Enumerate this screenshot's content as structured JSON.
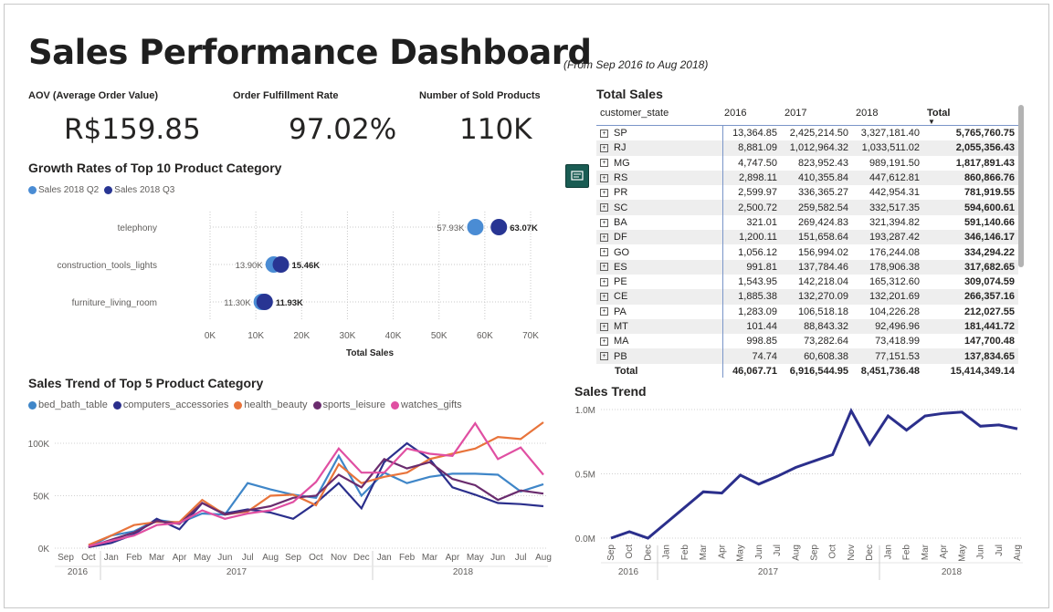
{
  "header": {
    "title": "Sales Performance Dashboard",
    "subtitle": "(From Sep 2016 to Aug 2018)"
  },
  "kpis": [
    {
      "label": "AOV (Average Order Value)",
      "value": "R$159.85"
    },
    {
      "label": "Order Fulfillment Rate",
      "value": "97.02%"
    },
    {
      "label": "Number of Sold Products",
      "value": "110K"
    }
  ],
  "colors": {
    "q2": "#4a8cd4",
    "q3": "#283593",
    "bed_bath_table": "#3f86c8",
    "computers_accessories": "#2b2f8c",
    "health_beauty": "#e8743b",
    "sports_leisure": "#6a2c6e",
    "watches_gifts": "#e04fa2",
    "trend": "#2b2f8c"
  },
  "growth_chart": {
    "title": "Growth Rates of Top 10 Product Category",
    "legend": [
      "Sales 2018 Q2",
      "Sales 2018 Q3"
    ],
    "xlabel": "Total Sales",
    "ticks": [
      "0K",
      "10K",
      "20K",
      "30K",
      "40K",
      "50K",
      "60K",
      "70K"
    ]
  },
  "trend5": {
    "title": "Sales Trend of Top 5 Product Category",
    "legend": [
      "bed_bath_table",
      "computers_accessories",
      "health_beauty",
      "sports_leisure",
      "watches_gifts"
    ],
    "yticks": [
      "100K",
      "50K",
      "0K"
    ],
    "months": [
      "Sep",
      "Oct",
      "Jan",
      "Feb",
      "Mar",
      "Apr",
      "May",
      "Jun",
      "Jul",
      "Aug",
      "Sep",
      "Oct",
      "Nov",
      "Dec",
      "Jan",
      "Feb",
      "Mar",
      "Apr",
      "May",
      "Jun",
      "Jul",
      "Aug"
    ],
    "years": [
      "2016",
      "2017",
      "2018"
    ]
  },
  "sales_trend": {
    "title": "Sales Trend",
    "yticks": [
      "1.0M",
      "0.5M",
      "0.0M"
    ],
    "months": [
      "Sep",
      "Oct",
      "Dec",
      "Jan",
      "Feb",
      "Mar",
      "Apr",
      "May",
      "Jun",
      "Jul",
      "Aug",
      "Sep",
      "Oct",
      "Nov",
      "Dec",
      "Jan",
      "Feb",
      "Mar",
      "Apr",
      "May",
      "Jun",
      "Jul",
      "Aug"
    ],
    "years": [
      "2016",
      "2017",
      "2018"
    ]
  },
  "table": {
    "title": "Total Sales",
    "columns": [
      "customer_state",
      "2016",
      "2017",
      "2018",
      "Total"
    ],
    "rows": [
      [
        "SP",
        "13,364.85",
        "2,425,214.50",
        "3,327,181.40",
        "5,765,760.75"
      ],
      [
        "RJ",
        "8,881.09",
        "1,012,964.32",
        "1,033,511.02",
        "2,055,356.43"
      ],
      [
        "MG",
        "4,747.50",
        "823,952.43",
        "989,191.50",
        "1,817,891.43"
      ],
      [
        "RS",
        "2,898.11",
        "410,355.84",
        "447,612.81",
        "860,866.76"
      ],
      [
        "PR",
        "2,599.97",
        "336,365.27",
        "442,954.31",
        "781,919.55"
      ],
      [
        "SC",
        "2,500.72",
        "259,582.54",
        "332,517.35",
        "594,600.61"
      ],
      [
        "BA",
        "321.01",
        "269,424.83",
        "321,394.82",
        "591,140.66"
      ],
      [
        "DF",
        "1,200.11",
        "151,658.64",
        "193,287.42",
        "346,146.17"
      ],
      [
        "GO",
        "1,056.12",
        "156,994.02",
        "176,244.08",
        "334,294.22"
      ],
      [
        "ES",
        "991.81",
        "137,784.46",
        "178,906.38",
        "317,682.65"
      ],
      [
        "PE",
        "1,543.95",
        "142,218.04",
        "165,312.60",
        "309,074.59"
      ],
      [
        "CE",
        "1,885.38",
        "132,270.09",
        "132,201.69",
        "266,357.16"
      ],
      [
        "PA",
        "1,283.09",
        "106,518.18",
        "104,226.28",
        "212,027.55"
      ],
      [
        "MT",
        "101.44",
        "88,843.32",
        "92,496.96",
        "181,441.72"
      ],
      [
        "MA",
        "998.85",
        "73,282.64",
        "73,418.99",
        "147,700.48"
      ],
      [
        "PB",
        "74.74",
        "60,608.38",
        "77,151.53",
        "137,834.65"
      ]
    ],
    "total": [
      "Total",
      "46,067.71",
      "6,916,544.95",
      "8,451,736.48",
      "15,414,349.14"
    ]
  },
  "chart_data": [
    {
      "type": "scatter",
      "title": "Growth Rates of Top 10 Product Category",
      "xlabel": "Total Sales",
      "xlim": [
        0,
        70000
      ],
      "categories": [
        "telephony",
        "construction_tools_lights",
        "furniture_living_room"
      ],
      "series": [
        {
          "name": "Sales 2018 Q2",
          "values": [
            57930,
            13900,
            11300
          ],
          "labels": [
            "57.93K",
            "13.90K",
            "11.30K"
          ]
        },
        {
          "name": "Sales 2018 Q3",
          "values": [
            63070,
            15460,
            11930
          ],
          "labels": [
            "63.07K",
            "15.46K",
            "11.93K"
          ]
        }
      ]
    },
    {
      "type": "line",
      "title": "Sales Trend of Top 5 Product Category",
      "ylim": [
        0,
        120000
      ],
      "x": [
        "Sep 2016",
        "Oct 2016",
        "Jan 2017",
        "Feb 2017",
        "Mar 2017",
        "Apr 2017",
        "May 2017",
        "Jun 2017",
        "Jul 2017",
        "Aug 2017",
        "Sep 2017",
        "Oct 2017",
        "Nov 2017",
        "Dec 2017",
        "Jan 2018",
        "Feb 2018",
        "Mar 2018",
        "Apr 2018",
        "May 2018",
        "Jun 2018",
        "Jul 2018",
        "Aug 2018"
      ],
      "series": [
        {
          "name": "bed_bath_table",
          "values": [
            null,
            1000,
            12000,
            16000,
            27000,
            24000,
            33000,
            32000,
            62000,
            56000,
            51000,
            48000,
            88000,
            50000,
            72000,
            62000,
            68000,
            71000,
            71000,
            70000,
            54000,
            61000
          ]
        },
        {
          "name": "computers_accessories",
          "values": [
            null,
            1000,
            5000,
            13000,
            28000,
            18000,
            43000,
            33000,
            37000,
            34000,
            28000,
            43000,
            62000,
            38000,
            82000,
            100000,
            85000,
            58000,
            51000,
            43000,
            42000,
            40000
          ]
        },
        {
          "name": "health_beauty",
          "values": [
            null,
            3000,
            12000,
            22000,
            25000,
            25000,
            46000,
            32000,
            35000,
            50000,
            51000,
            41000,
            80000,
            62000,
            68000,
            72000,
            85000,
            90000,
            95000,
            106000,
            104000,
            120000
          ]
        },
        {
          "name": "sports_leisure",
          "values": [
            null,
            1000,
            8000,
            15000,
            26000,
            23000,
            43000,
            32000,
            36000,
            40000,
            48000,
            50000,
            70000,
            58000,
            85000,
            76000,
            82000,
            66000,
            60000,
            46000,
            55000,
            52000
          ]
        },
        {
          "name": "watches_gifts",
          "values": [
            null,
            2000,
            7000,
            12000,
            22000,
            24000,
            36000,
            28000,
            33000,
            36000,
            44000,
            63000,
            95000,
            72000,
            72000,
            95000,
            90000,
            88000,
            119000,
            85000,
            96000,
            70000
          ]
        }
      ]
    },
    {
      "type": "line",
      "title": "Sales Trend",
      "ylim": [
        0,
        1000000
      ],
      "x": [
        "Sep 2016",
        "Oct 2016",
        "Dec 2016",
        "Jan 2017",
        "Feb 2017",
        "Mar 2017",
        "Apr 2017",
        "May 2017",
        "Jun 2017",
        "Jul 2017",
        "Aug 2017",
        "Sep 2017",
        "Oct 2017",
        "Nov 2017",
        "Dec 2017",
        "Jan 2018",
        "Feb 2018",
        "Mar 2018",
        "Apr 2018",
        "May 2018",
        "Jun 2018",
        "Jul 2018",
        "Aug 2018"
      ],
      "series": [
        {
          "name": "Sales",
          "values": [
            0,
            50000,
            0,
            120000,
            240000,
            360000,
            350000,
            490000,
            420000,
            480000,
            550000,
            600000,
            650000,
            990000,
            730000,
            950000,
            840000,
            950000,
            970000,
            980000,
            870000,
            880000,
            850000
          ]
        }
      ]
    }
  ]
}
